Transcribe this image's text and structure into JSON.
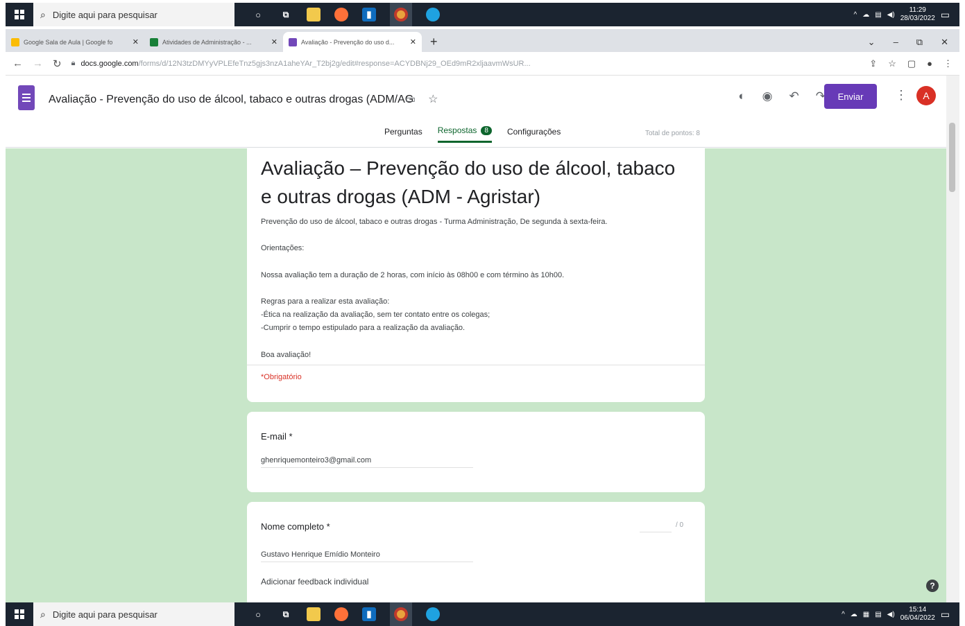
{
  "taskbar_top": {
    "search_placeholder": "Digite aqui para pesquisar",
    "time": "11:29",
    "date": "28/03/2022"
  },
  "taskbar_bottom": {
    "search_placeholder": "Digite aqui para pesquisar",
    "time": "15:14",
    "date": "06/04/2022"
  },
  "browser": {
    "tabs": [
      {
        "title": "Google Sala de Aula | Google fo",
        "favicon_color": "#fbbc04"
      },
      {
        "title": "Atividades de Administração - ...",
        "favicon_color": "#188038"
      },
      {
        "title": "Avaliação - Prevenção do uso d...",
        "favicon_color": "#7248b9"
      }
    ],
    "url_host": "docs.google.com",
    "url_path": "/forms/d/12N3tzDMYyVPLEfeTnz5gjs3nzA1aheYAr_T2bj2g/edit#response=ACYDBNj29_OEd9mR2xljaavmWsUR..."
  },
  "forms_header": {
    "doc_title": "Avaliação - Prevenção do uso de álcool, tabaco e outras drogas (ADM/AG",
    "send_label": "Enviar",
    "avatar_letter": "A",
    "tabs": {
      "questions": "Perguntas",
      "responses": "Respostas",
      "responses_count": "8",
      "settings": "Configurações"
    },
    "total_points": "Total de pontos: 8"
  },
  "form": {
    "title": "Avaliação – Prevenção do uso de álcool, tabaco e outras drogas (ADM - Agristar)",
    "description_line1": "Prevenção do uso de álcool, tabaco e outras drogas  - Turma Administração, De segunda à sexta-feira.",
    "orientations_label": "Orientações:",
    "duration_text": "Nossa avaliação tem a duração de  2 horas, com início às 08h00 e com término às 10h00.",
    "rules_title": "Regras para a realizar esta avaliação:",
    "rule1": "-Ética na realização da avaliação, sem ter contato entre os colegas;",
    "rule2": "-Cumprir o tempo estipulado para a realização da avaliação.",
    "closing": "Boa avaliação!",
    "required_note": "*Obrigatório"
  },
  "questions": [
    {
      "label": "E-mail *",
      "answer": "ghenriquemonteiro3@gmail.com"
    },
    {
      "label": "Nome completo *",
      "answer": "Gustavo Henrique Emídio Monteiro",
      "points_max": "/ 0",
      "feedback_link": "Adicionar feedback individual"
    }
  ]
}
